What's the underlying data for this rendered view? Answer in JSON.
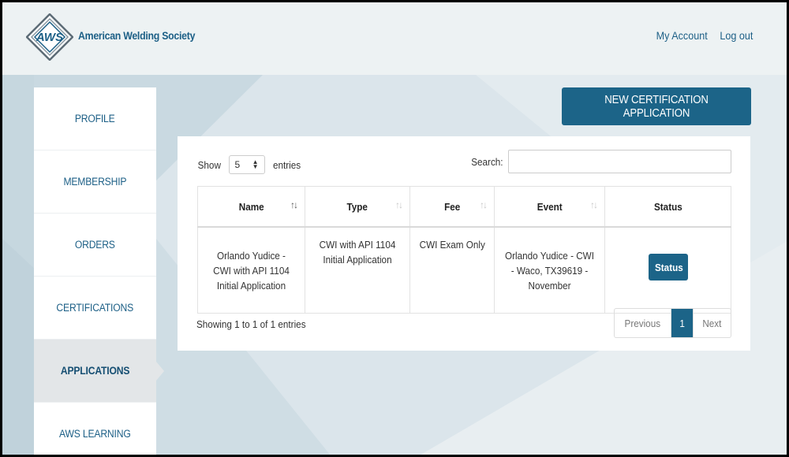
{
  "header": {
    "logo_text": "AWS",
    "brand": "American Welding Society",
    "links": [
      "My Account",
      "Log out"
    ]
  },
  "sidebar": {
    "items": [
      {
        "label": "PROFILE"
      },
      {
        "label": "MEMBERSHIP"
      },
      {
        "label": "ORDERS"
      },
      {
        "label": "CERTIFICATIONS"
      },
      {
        "label": "APPLICATIONS",
        "active": true
      },
      {
        "label": "AWS LEARNING"
      }
    ]
  },
  "main": {
    "new_button": "NEW CERTIFICATION APPLICATION",
    "table_controls": {
      "show_label": "Show",
      "page_length": "5",
      "entries_label": "entries",
      "search_label": "Search:",
      "search_value": ""
    },
    "table": {
      "columns": [
        "Name",
        "Type",
        "Fee",
        "Event",
        "Status"
      ],
      "rows": [
        {
          "name": "Orlando Yudice - CWI with API 1104 Initial Application",
          "type": "CWI with API 1104 Initial Application",
          "fee": "CWI Exam Only",
          "event": "Orlando Yudice - CWI - Waco, TX39619 - November",
          "status_button": "Status"
        }
      ]
    },
    "info": "Showing 1 to 1 of 1 entries",
    "pagination": {
      "previous": "Previous",
      "current": "1",
      "next": "Next"
    }
  },
  "colors": {
    "accent": "#1c6488",
    "link": "#1c5f86",
    "background": "#dbe5eb",
    "header_bg": "#edf2f3"
  },
  "icons": {
    "sort": "sort-arrows-icon",
    "select": "select-arrows-icon",
    "logo": "aws-logo"
  }
}
